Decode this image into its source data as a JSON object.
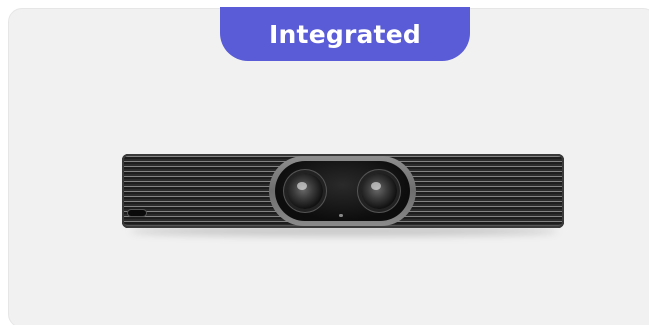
{
  "card": {
    "badge_label": "Integrated"
  },
  "product": {
    "image_icon": "video-bar-camera-icon"
  },
  "colors": {
    "badge_background": "#5a5bd6",
    "badge_text": "#ffffff",
    "card_background": "#f1f1f1"
  }
}
